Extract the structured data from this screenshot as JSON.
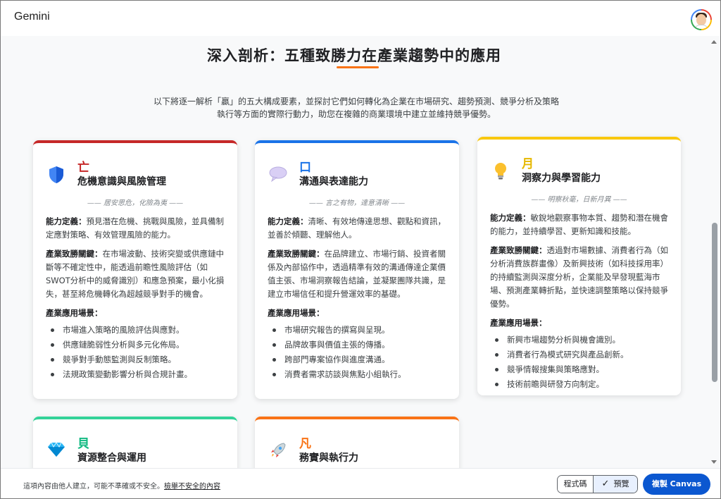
{
  "app": {
    "brand": "Gemini"
  },
  "section": {
    "title": "深入剖析：五種致勝力在產業趨勢中的應用",
    "intro_line1": "以下將逐一解析「贏」的五大構成要素，並探討它們如何轉化為企業在市場研究、趨勢預測、競爭分析及策略",
    "intro_line2": "執行等方面的實際行動力，助您在複雜的商業環境中建立並維持競爭優勢。"
  },
  "cards": [
    {
      "char": "亡",
      "name": "危機意識與風險管理",
      "motto": "—— 居安思危，化險為夷 ——",
      "color": "#c62828",
      "icon": "shield-icon",
      "def_label": "能力定義：",
      "def": "預見潛在危機、挑戰與風險，並具備制定應對策略、有效管理風險的能力。",
      "key_label": "產業致勝關鍵：",
      "key": "在市場波動、技術突變或供應鏈中斷等不確定性中，能透過前瞻性風險評估（如SWOT分析中的威脅識別）和應急預案，最小化損失，甚至將危機轉化為超越競爭對手的機會。",
      "scen_label": "產業應用場景：",
      "items": [
        "市場進入策略的風險評估與應對。",
        "供應鏈脆弱性分析與多元化佈局。",
        "競爭對手動態監測與反制策略。",
        "法規政策變動影響分析與合規計畫。"
      ]
    },
    {
      "char": "口",
      "name": "溝通與表達能力",
      "motto": "—— 言之有物，達意清晰 ——",
      "color": "#1a73e8",
      "icon": "speech-bubble-icon",
      "def_label": "能力定義：",
      "def": "清晰、有效地傳達思想、觀點和資訊，並善於傾聽、理解他人。",
      "key_label": "產業致勝關鍵：",
      "key": "在品牌建立、市場行銷、投資者關係及內部協作中，透過精準有效的溝通傳達企業價值主張、市場洞察報告結論，並凝聚團隊共識，是建立市場信任和提升營運效率的基礎。",
      "scen_label": "產業應用場景：",
      "items": [
        "市場研究報告的撰寫與呈現。",
        "品牌故事與價值主張的傳播。",
        "跨部門專案協作與進度溝通。",
        "消費者需求訪談與焦點小組執行。"
      ]
    },
    {
      "char": "月",
      "name": "洞察力與學習能力",
      "motto": "—— 明察秋毫，日新月異 ——",
      "color": "#f9c80e",
      "icon": "lightbulb-icon",
      "def_label": "能力定義：",
      "def": "敏銳地觀察事物本質、趨勢和潛在機會的能力，並持續學習、更新知識和技能。",
      "key_label": "產業致勝關鍵：",
      "key": "透過對市場數據、消費者行為（如分析消費族群畫像）及新興技術（如科技採用率）的持續監測與深度分析，企業能及早發現藍海市場、預測產業轉折點，並快速調整策略以保持競爭優勢。",
      "scen_label": "產業應用場景：",
      "items": [
        "新興市場趨勢分析與機會識別。",
        "消費者行為模式研究與產品創新。",
        "競爭情報搜集與策略應對。",
        "技術前瞻與研發方向制定。"
      ]
    },
    {
      "char": "貝",
      "name": "資源整合與運用",
      "color": "#34d399",
      "icon": "gem-icon"
    },
    {
      "char": "凡",
      "name": "務實與執行力",
      "color": "#f97316",
      "icon": "rocket-icon"
    }
  ],
  "footer": {
    "disclaimer": "這項內容由他人建立，可能不準確或不安全。",
    "report_link": "檢舉不安全的內容",
    "code_label": "程式碼",
    "preview_label": "預覽",
    "copy_label": "複製 Canvas"
  }
}
